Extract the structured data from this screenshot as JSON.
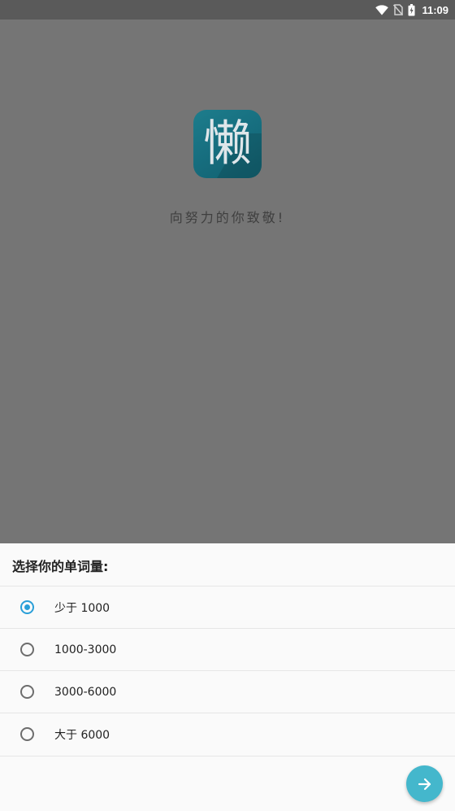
{
  "status_bar": {
    "time": "11:09",
    "icons": [
      "wifi-icon",
      "no-sim-icon",
      "battery-charging-icon"
    ]
  },
  "splash": {
    "logo_char": "懒",
    "tagline": "向努力的你致敬!"
  },
  "sheet": {
    "title": "选择你的单词量:",
    "options": [
      {
        "label": "少于 1000",
        "selected": true
      },
      {
        "label": "1000-3000",
        "selected": false
      },
      {
        "label": "3000-6000",
        "selected": false
      },
      {
        "label": "大于 6000",
        "selected": false
      }
    ],
    "next_icon": "arrow-right-icon"
  },
  "colors": {
    "accent": "#2a9fd8",
    "fab": "#44b7cc",
    "logo": "#176f80",
    "scrim": "#757575"
  }
}
